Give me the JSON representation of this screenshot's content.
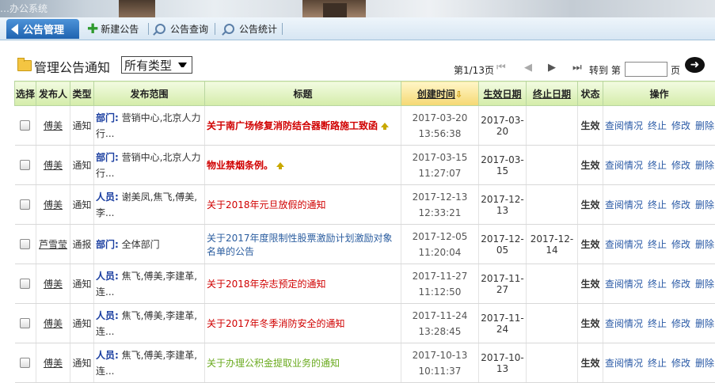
{
  "banner": {
    "text": "…办公系统"
  },
  "tabs": [
    {
      "label": "公告管理",
      "active": true
    },
    {
      "label": "新建公告",
      "icon": "plus-icon"
    },
    {
      "label": "公告查询",
      "icon": "search-icon"
    },
    {
      "label": "公告统计",
      "icon": "search-icon"
    }
  ],
  "toolbar": {
    "title": "管理公告通知",
    "type_select": "所有类型",
    "page_info": "第1/13页",
    "goto_label": "转到 第",
    "page_unit": "页",
    "go_button": "➜"
  },
  "table": {
    "headers": [
      "选择",
      "发布人",
      "类型",
      "发布范围",
      "标题",
      "创建时间",
      "生效日期",
      "终止日期",
      "状态",
      "操作"
    ],
    "ops": [
      "查阅情况",
      "终止",
      "修改",
      "删除"
    ],
    "rows": [
      {
        "publisher": "傅美",
        "type": "通知",
        "scope_label": "部门:",
        "scope": "营销中心,北京人力行...",
        "title": "关于南广场修复消防结合器断路施工致函",
        "title_style": "red-bold",
        "arrow": true,
        "created_date": "2017-03-20",
        "created_time": "13:56:38",
        "start": "2017-03-20",
        "end": "",
        "status": "生效"
      },
      {
        "publisher": "傅美",
        "type": "通知",
        "scope_label": "部门:",
        "scope": "营销中心,北京人力行...",
        "title": "物业禁烟条例。",
        "title_style": "red-bold",
        "arrow": true,
        "created_date": "2017-03-15",
        "created_time": "11:27:07",
        "start": "2017-03-15",
        "end": "",
        "status": "生效"
      },
      {
        "publisher": "傅美",
        "type": "通知",
        "scope_label": "人员:",
        "scope": "谢美凤,焦飞,傅美,李...",
        "title": "关于2018年元旦放假的通知",
        "title_style": "red",
        "arrow": false,
        "created_date": "2017-12-13",
        "created_time": "12:33:21",
        "start": "2017-12-13",
        "end": "",
        "status": "生效"
      },
      {
        "publisher": "芦雪莹",
        "type": "通报",
        "scope_label": "部门:",
        "scope": "全体部门",
        "title": "关于2017年度限制性股票激励计划激励对象名单的公告",
        "title_style": "blue",
        "arrow": false,
        "created_date": "2017-12-05",
        "created_time": "11:20:04",
        "start": "2017-12-05",
        "end": "2017-12-14",
        "status": "生效"
      },
      {
        "publisher": "傅美",
        "type": "通知",
        "scope_label": "人员:",
        "scope": "焦飞,傅美,李建革,连...",
        "title": "关于2018年杂志预定的通知",
        "title_style": "red",
        "arrow": false,
        "created_date": "2017-11-27",
        "created_time": "11:12:50",
        "start": "2017-11-27",
        "end": "",
        "status": "生效"
      },
      {
        "publisher": "傅美",
        "type": "通知",
        "scope_label": "人员:",
        "scope": "焦飞,傅美,李建革,连...",
        "title": "关于2017年冬季消防安全的通知",
        "title_style": "red",
        "arrow": false,
        "created_date": "2017-11-24",
        "created_time": "13:28:45",
        "start": "2017-11-24",
        "end": "",
        "status": "生效"
      },
      {
        "publisher": "傅美",
        "type": "通知",
        "scope_label": "人员:",
        "scope": "焦飞,傅美,李建革,连...",
        "title": "关于办理公积金提取业务的通知",
        "title_style": "green",
        "arrow": false,
        "created_date": "2017-10-13",
        "created_time": "10:11:37",
        "start": "2017-10-13",
        "end": "",
        "status": "生效"
      }
    ]
  }
}
